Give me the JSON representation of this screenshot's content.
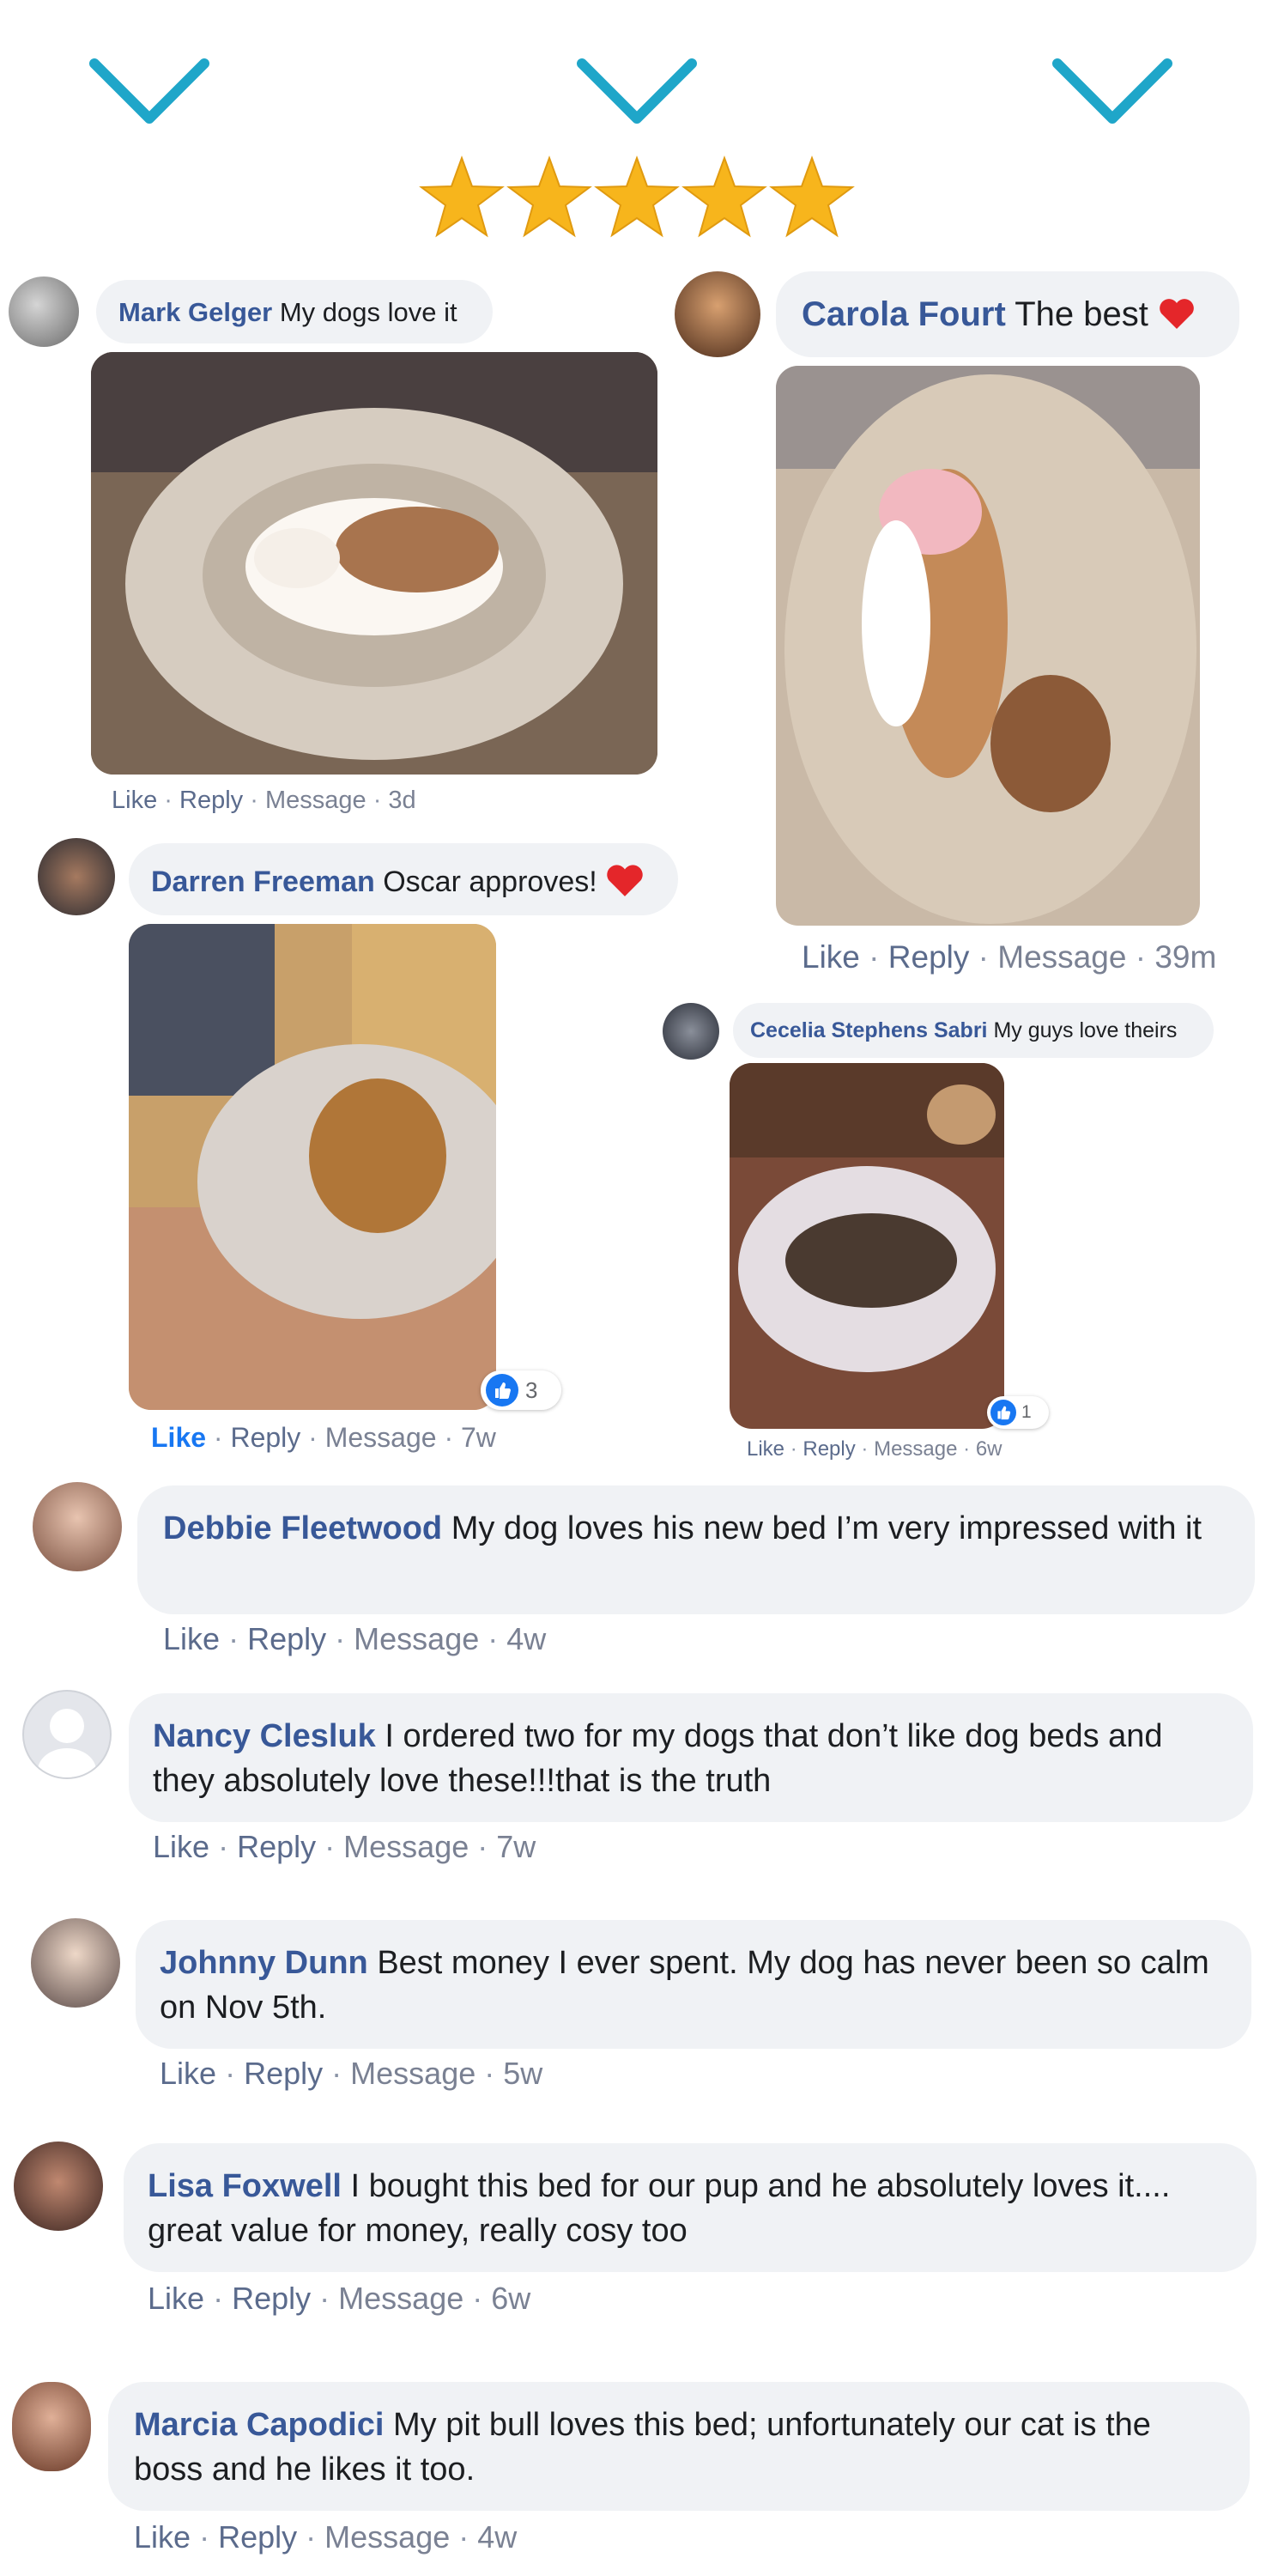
{
  "rating": {
    "stars": 5,
    "max": 5,
    "color": "#f7b51c"
  },
  "icons": {
    "chevron": "chevron-down-icon",
    "star": "star-icon",
    "thumb": "thumbs-up-icon",
    "heart": "heart-icon",
    "avatar_placeholder": "user-avatar-icon"
  },
  "colors": {
    "accent": "#1fa6c9",
    "name": "#385898",
    "bubble": "#f0f2f5",
    "like_active": "#1877f2"
  },
  "actions": {
    "like": "Like",
    "reply": "Reply",
    "message": "Message",
    "sep": "·"
  },
  "comments": [
    {
      "name": "Mark Gelger",
      "text": "My dogs love it",
      "time": "3d"
    },
    {
      "name": "Carola Fourt",
      "text": "The best",
      "time": "39m"
    },
    {
      "name": "Darren Freeman",
      "text": "Oscar approves!",
      "time": "7w",
      "likes": "3"
    },
    {
      "name": "Cecelia Stephens Sabri",
      "text": "My guys love theirs",
      "time": "6w",
      "likes": "1"
    },
    {
      "name": "Debbie Fleetwood",
      "text": "My dog loves his new bed I’m very impressed with it",
      "time": "4w"
    },
    {
      "name": "Nancy Clesluk",
      "text": "I ordered two for my dogs that don’t like dog beds and they absolutely love these!!!that is the truth",
      "time": "7w"
    },
    {
      "name": "Johnny Dunn",
      "text": "Best money I ever spent. My dog has never been so calm on Nov 5th.",
      "time": "5w"
    },
    {
      "name": "Lisa Foxwell",
      "text": "I bought this bed for our pup and he absolutely loves it.... great value for money, really cosy too",
      "time": "6w"
    },
    {
      "name": "Marcia Capodici",
      "text": "My pit bull loves this bed; unfortunately our cat is the boss and he likes it too.",
      "time": "4w"
    }
  ]
}
